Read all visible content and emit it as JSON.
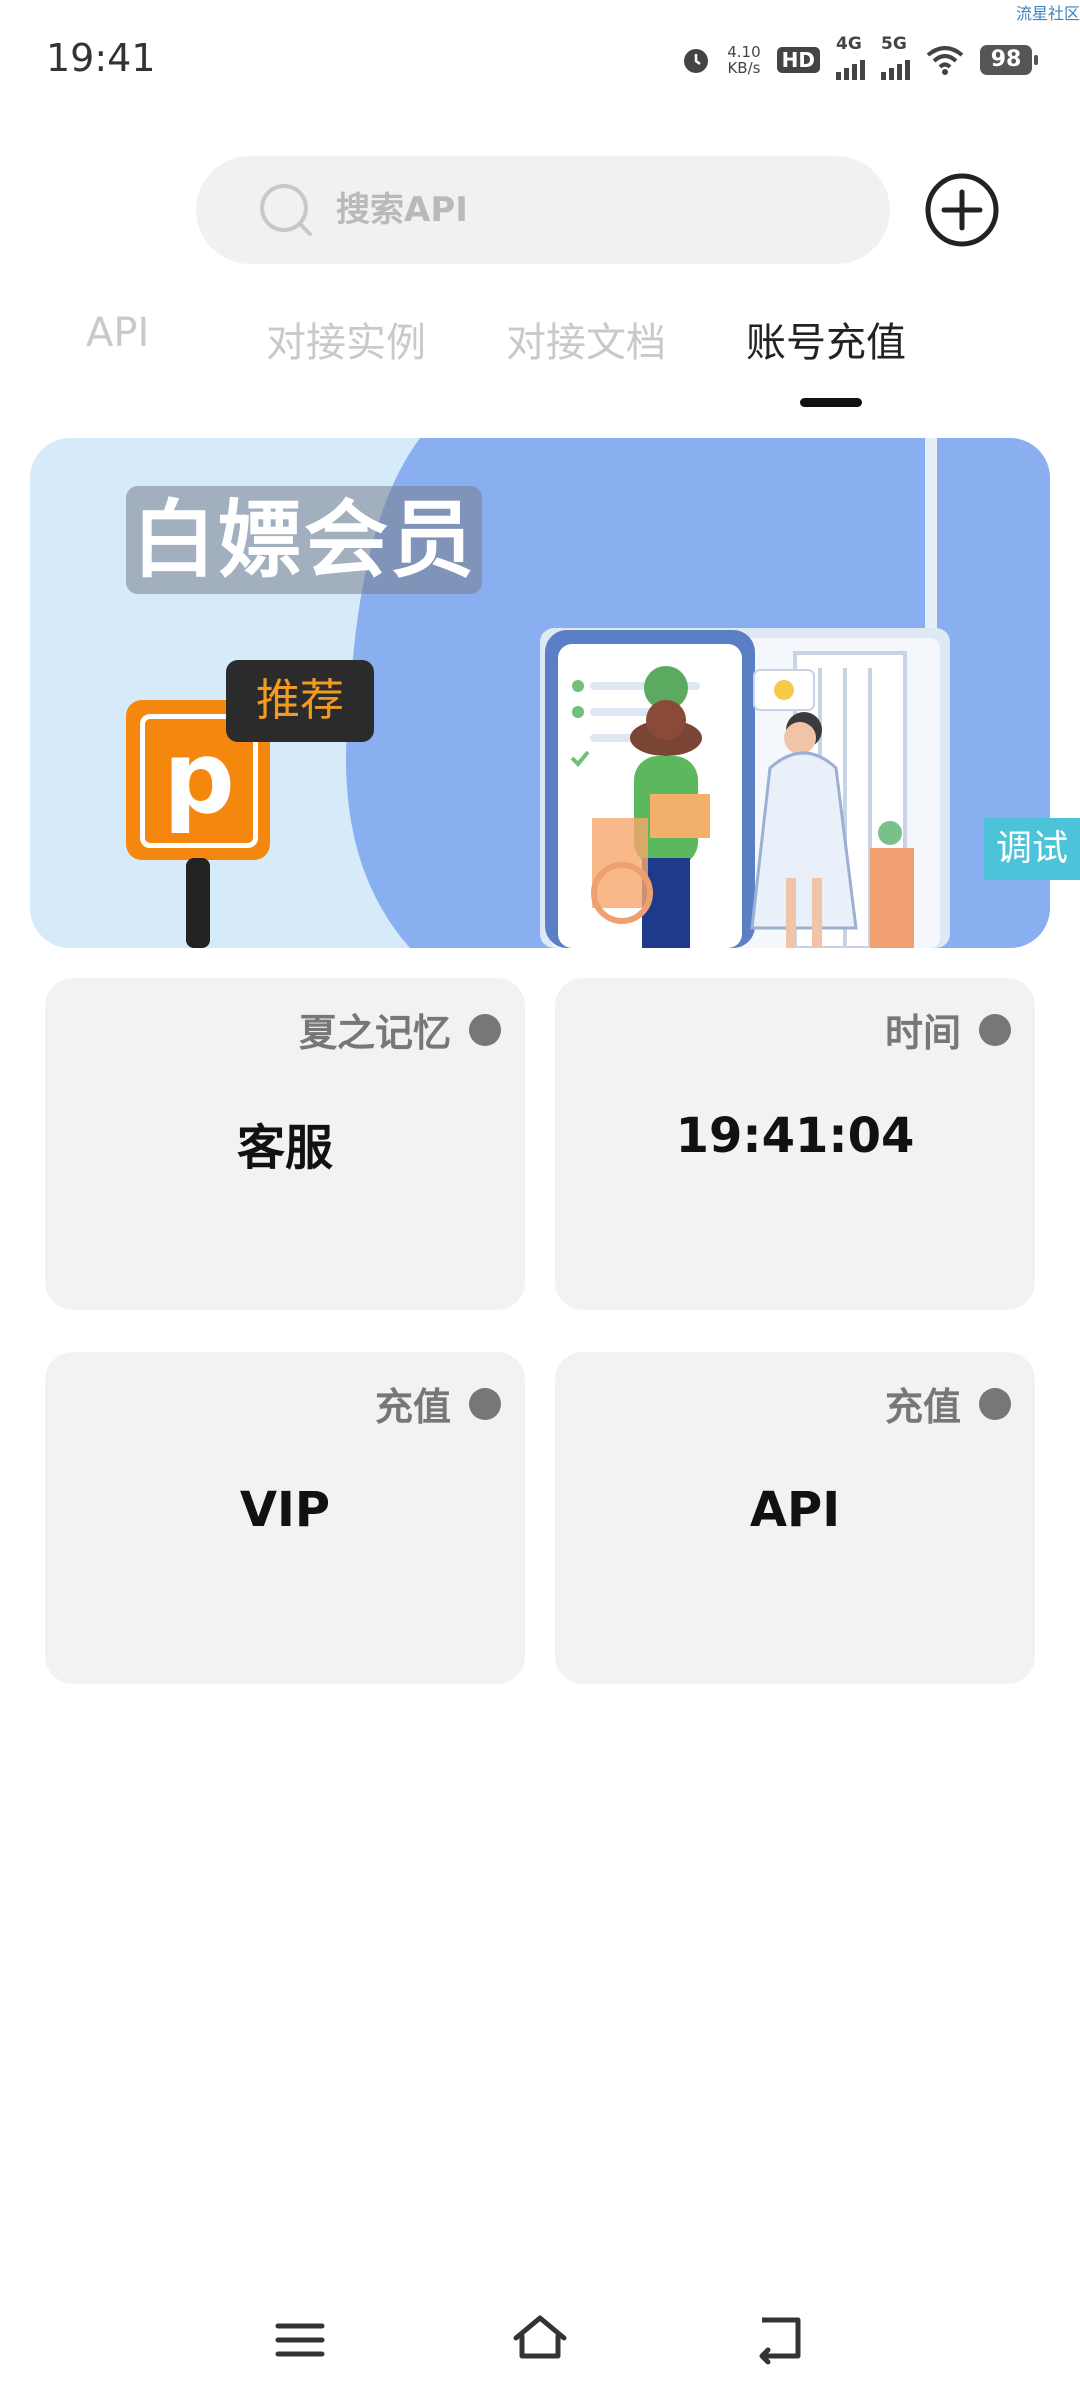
{
  "status_bar": {
    "time": "19:41",
    "watermark": "流星社区",
    "net_speed_value": "4.10",
    "net_speed_unit": "KB/s",
    "hd_label": "HD",
    "sim1_label": "4G",
    "sim2_label": "5G",
    "battery": "98"
  },
  "search": {
    "placeholder": "搜索API"
  },
  "tabs": [
    {
      "label": "API",
      "active": false
    },
    {
      "label": "对接实例",
      "active": false
    },
    {
      "label": "对接文档",
      "active": false
    },
    {
      "label": "账号充值",
      "active": true
    }
  ],
  "banner": {
    "title": "白嫖会员",
    "badge": "推荐",
    "sign_letter": "p"
  },
  "debug_button": "调试",
  "cards": [
    {
      "title": "夏之记忆",
      "value": "客服"
    },
    {
      "title": "时间",
      "value": "19:41:04"
    },
    {
      "title": "充值",
      "value": "VIP"
    },
    {
      "title": "充值",
      "value": "API"
    }
  ],
  "colors": {
    "accent_tab_indicator": "#111111",
    "card_background": "#f2f2f2",
    "debug_button": "#4cc3d8",
    "banner_blue": "#8aaff0",
    "banner_light": "#d6ebfa",
    "sign_orange": "#f5870f"
  },
  "icons": {
    "search": "search-icon",
    "add": "plus-circle-icon",
    "nav_menu": "menu-icon",
    "nav_home": "home-icon",
    "nav_back": "back-icon"
  }
}
